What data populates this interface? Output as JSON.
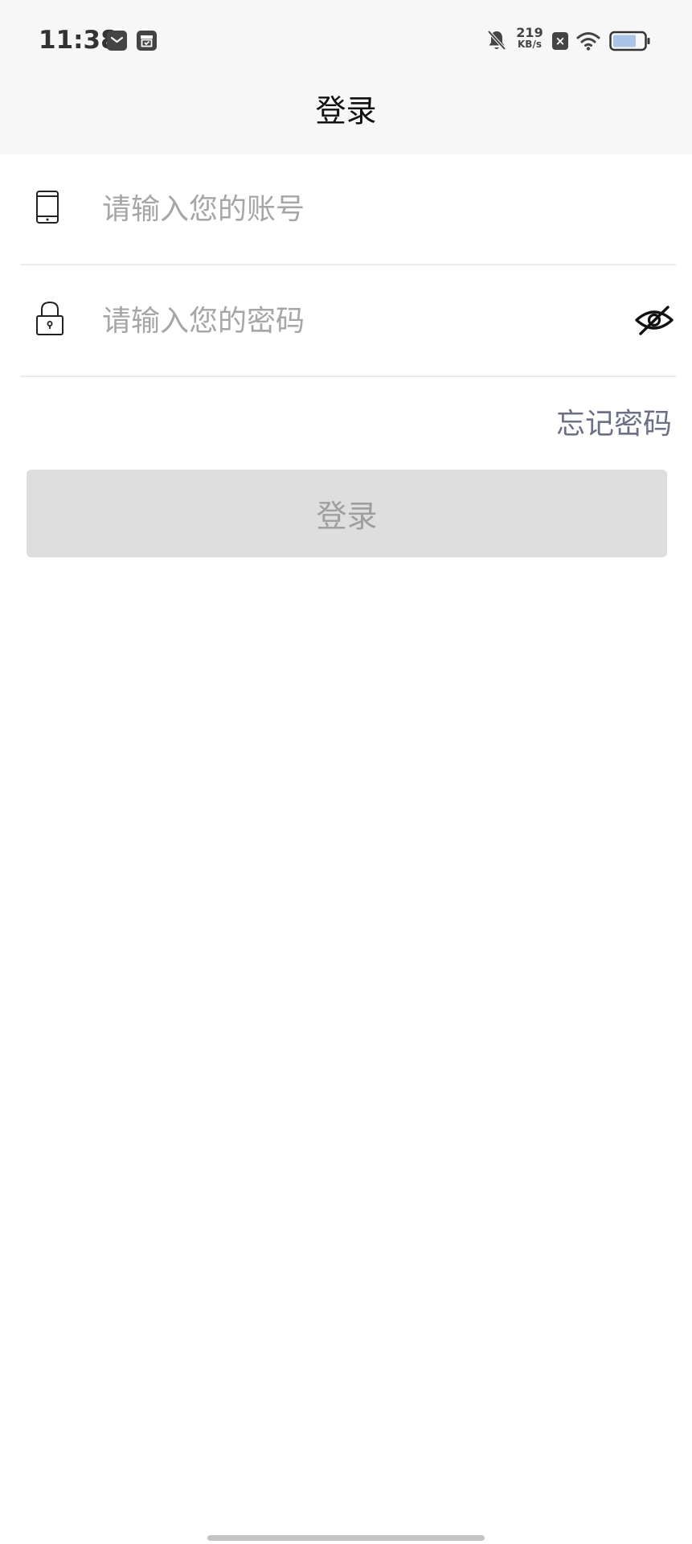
{
  "status_bar": {
    "time": "11:38",
    "net_speed_value": "219",
    "net_speed_unit": "KB/s",
    "icons": [
      "mail-notification-icon",
      "calendar-notification-icon",
      "bell-mute-icon",
      "sim-no-service-icon",
      "wifi-icon",
      "battery-icon"
    ]
  },
  "header": {
    "title": "登录"
  },
  "form": {
    "account": {
      "placeholder": "请输入您的账号",
      "value": "",
      "icon": "phone-icon"
    },
    "password": {
      "placeholder": "请输入您的密码",
      "value": "",
      "icon": "lock-icon",
      "toggle_icon": "eye-off-icon"
    },
    "forgot_label": "忘记密码",
    "submit_label": "登录"
  },
  "colors": {
    "header_bg": "#f7f7f7",
    "button_bg_disabled": "#dedede",
    "button_text_disabled": "#9f9f9f",
    "link": "#6c6f86",
    "placeholder": "#a6a6a6"
  }
}
